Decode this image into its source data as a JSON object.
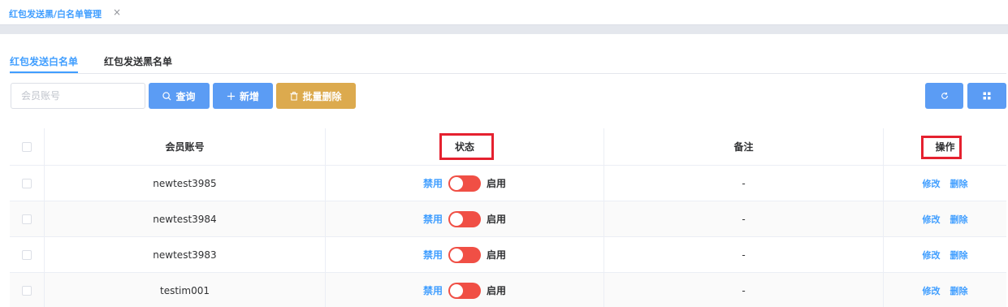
{
  "page_tab": {
    "title": "红包发送黑/白名单管理",
    "close": "×"
  },
  "subtabs": [
    {
      "label": "红包发送白名单",
      "active": true
    },
    {
      "label": "红包发送黑名单",
      "active": false
    }
  ],
  "toolbar": {
    "search_placeholder": "会员账号",
    "search_label": "查询",
    "add_label": "新增",
    "batch_delete_label": "批量删除"
  },
  "table": {
    "headers": {
      "account": "会员账号",
      "status": "状态",
      "remark": "备注",
      "op": "操作"
    },
    "rows": [
      {
        "account": "newtest3985",
        "off": "禁用",
        "on": "启用",
        "remark": "-",
        "edit": "修改",
        "delete": "删除"
      },
      {
        "account": "newtest3984",
        "off": "禁用",
        "on": "启用",
        "remark": "-",
        "edit": "修改",
        "delete": "删除"
      },
      {
        "account": "newtest3983",
        "off": "禁用",
        "on": "启用",
        "remark": "-",
        "edit": "修改",
        "delete": "删除"
      },
      {
        "account": "testim001",
        "off": "禁用",
        "on": "启用",
        "remark": "-",
        "edit": "修改",
        "delete": "删除"
      }
    ]
  },
  "colors": {
    "primary": "#409eff",
    "warning": "#dcaa4e",
    "switch": "#f04f45",
    "highlight": "#e5212f"
  }
}
